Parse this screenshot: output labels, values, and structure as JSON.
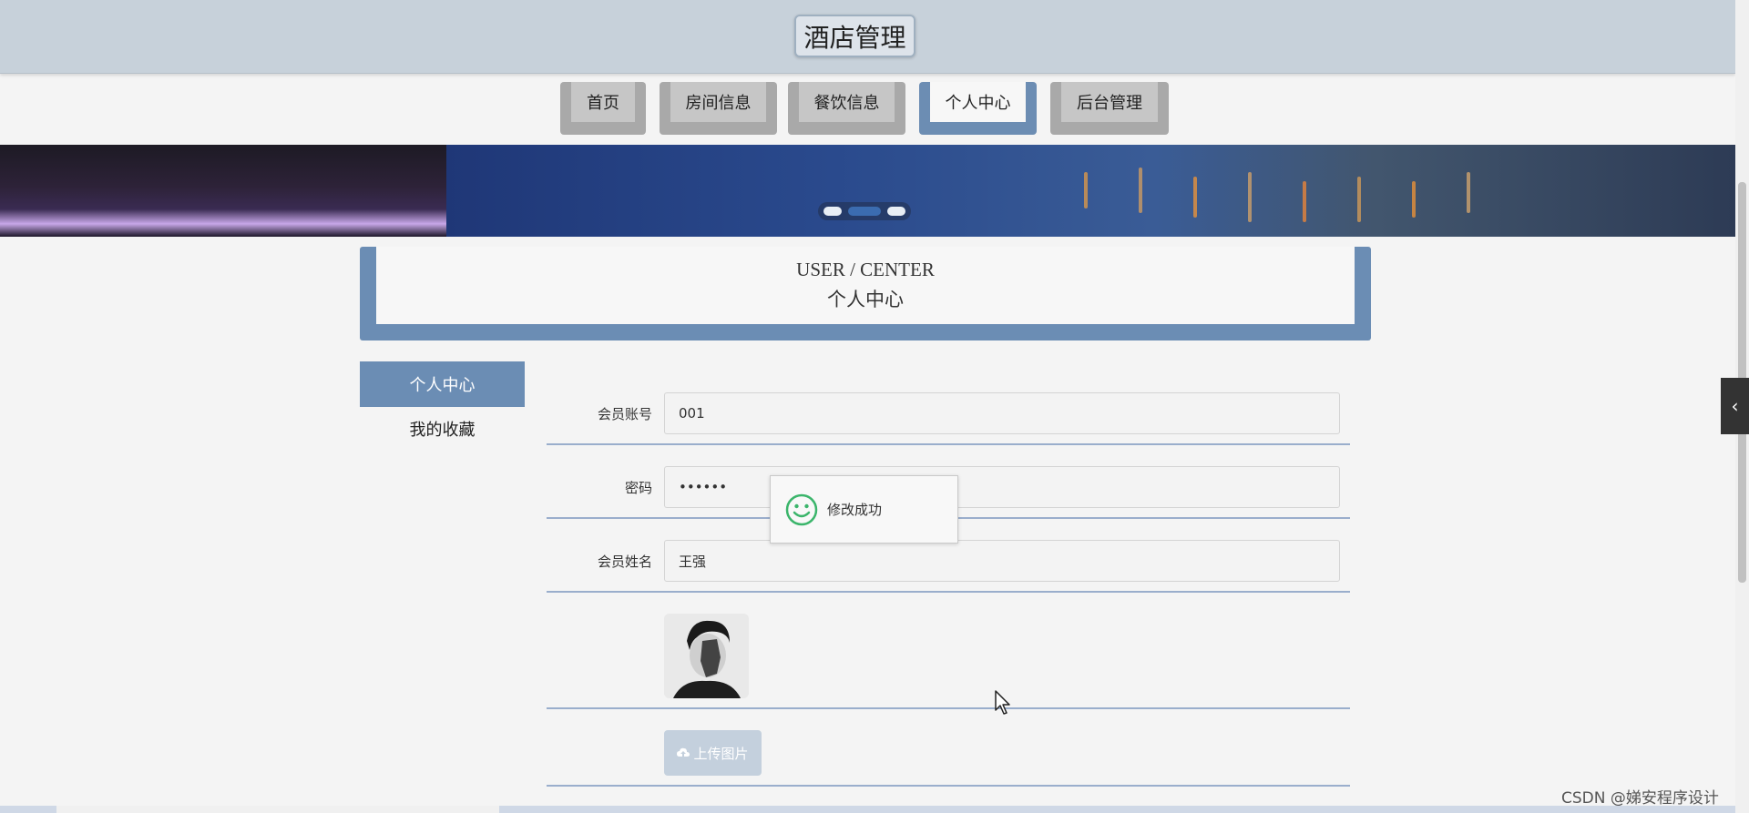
{
  "header": {
    "site_title": "酒店管理"
  },
  "nav": {
    "items": [
      {
        "label": "首页"
      },
      {
        "label": "房间信息"
      },
      {
        "label": "餐饮信息"
      },
      {
        "label": "个人中心",
        "active": true
      },
      {
        "label": "后台管理"
      }
    ]
  },
  "banner": {
    "slide_count": 3,
    "active_slide": 2
  },
  "section": {
    "title_en": "USER / CENTER",
    "title_cn": "个人中心"
  },
  "side_menu": {
    "items": [
      {
        "label": "个人中心",
        "active": true
      },
      {
        "label": "我的收藏"
      }
    ]
  },
  "form": {
    "account": {
      "label": "会员账号",
      "value": "001"
    },
    "password": {
      "label": "密码",
      "value": "••••••"
    },
    "name": {
      "label": "会员姓名",
      "value": "王强"
    },
    "upload_label": "上传图片"
  },
  "toast": {
    "message": "修改成功"
  },
  "watermark": "CSDN @娣安程序设计",
  "colors": {
    "accent": "#6b8db4",
    "header_bg": "#c7d1da",
    "toast_icon": "#3bb56b"
  },
  "icons": {
    "toast_icon": "smile-icon",
    "upload_icon": "cloud-upload-icon",
    "toggle_icon": "chevron-left-icon"
  }
}
